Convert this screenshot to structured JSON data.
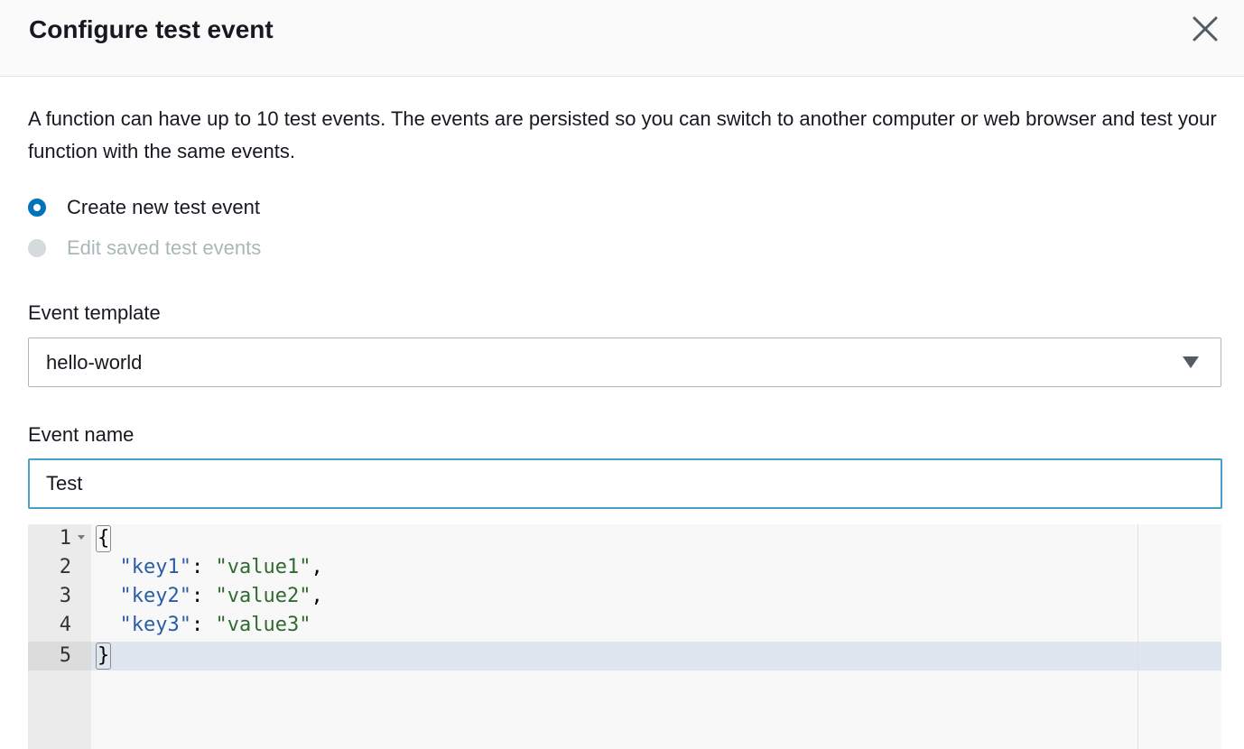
{
  "dialog": {
    "title": "Configure test event",
    "close_icon": "close-icon"
  },
  "description": "A function can have up to 10 test events. The events are persisted so you can switch to another computer or web browser and test your function with the same events.",
  "mode": {
    "options": [
      {
        "label": "Create new test event",
        "selected": true,
        "disabled": false
      },
      {
        "label": "Edit saved test events",
        "selected": false,
        "disabled": true
      }
    ]
  },
  "event_template": {
    "label": "Event template",
    "value": "hello-world"
  },
  "event_name": {
    "label": "Event name",
    "value": "Test"
  },
  "editor": {
    "line_numbers": [
      "1",
      "2",
      "3",
      "4",
      "5"
    ],
    "lines": [
      {
        "open_brace": "{"
      },
      {
        "indent": "  ",
        "key": "\"key1\"",
        "colon": ": ",
        "value": "\"value1\"",
        "trail": ","
      },
      {
        "indent": "  ",
        "key": "\"key2\"",
        "colon": ": ",
        "value": "\"value2\"",
        "trail": ","
      },
      {
        "indent": "  ",
        "key": "\"key3\"",
        "colon": ": ",
        "value": "\"value3\"",
        "trail": ""
      },
      {
        "close_brace": "}"
      }
    ],
    "active_line": 5
  },
  "colors": {
    "accent": "#0073bb",
    "focus_border": "#44a2c9",
    "json_key": "#2a5da8",
    "json_string": "#2f6a2f"
  }
}
